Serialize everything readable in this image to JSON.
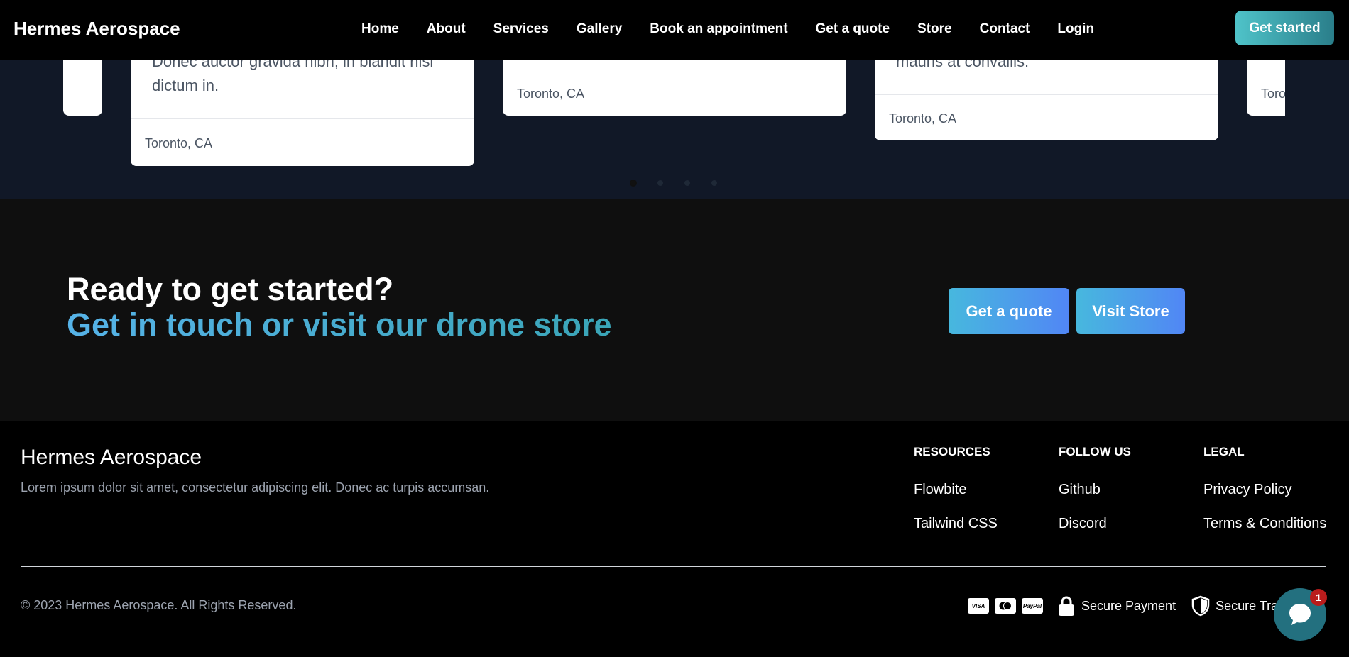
{
  "header": {
    "brand": "Hermes Aerospace",
    "nav": [
      "Home",
      "About",
      "Services",
      "Gallery",
      "Book an appointment",
      "Get a quote",
      "Store",
      "Contact",
      "Login"
    ],
    "cta": "Get started"
  },
  "testimonials": {
    "cards": [
      {
        "text": "",
        "location": ""
      },
      {
        "text": "Donec auctor gravida nibh, in blandit nisi dictum in.",
        "location": "Toronto, CA"
      },
      {
        "text": "",
        "location": "Toronto, CA"
      },
      {
        "text": "mauris at convallis.",
        "location": "Toronto, CA"
      },
      {
        "text": "",
        "location": "Toro"
      }
    ],
    "dots_count": 4,
    "active_dot": 1
  },
  "cta": {
    "heading": "Ready to get started?",
    "subheading": "Get in touch or visit our drone store",
    "quote_button": "Get a quote",
    "store_button": "Visit Store"
  },
  "footer": {
    "brand": "Hermes Aerospace",
    "description": "Lorem ipsum dolor sit amet, consectetur adipiscing elit. Donec ac turpis accumsan.",
    "resources": {
      "title": "RESOURCES",
      "links": [
        "Flowbite",
        "Tailwind CSS"
      ]
    },
    "follow": {
      "title": "FOLLOW US",
      "links": [
        "Github",
        "Discord"
      ]
    },
    "legal": {
      "title": "LEGAL",
      "links": [
        "Privacy Policy",
        "Terms & Conditions"
      ]
    },
    "copyright": "© 2023 Hermes Aerospace. All Rights Reserved.",
    "payment_icons": [
      "visa-icon",
      "mastercard-icon",
      "paypal-icon"
    ],
    "payment_labels": [
      "VISA",
      "MC",
      "PayPal"
    ],
    "secure_payment": "Secure Payment",
    "secure_transactions": "Secure Tra"
  },
  "chat": {
    "badge": "1",
    "icon": "chat-bubble-icon"
  },
  "colors": {
    "accent_gradient_start": "#56b3e8",
    "accent_gradient_end": "#3aa5b7",
    "button_gradient_end": "#5186f5",
    "section_dark": "#111827",
    "chat_bg": "#23707f",
    "badge_red": "#b91c1c"
  }
}
